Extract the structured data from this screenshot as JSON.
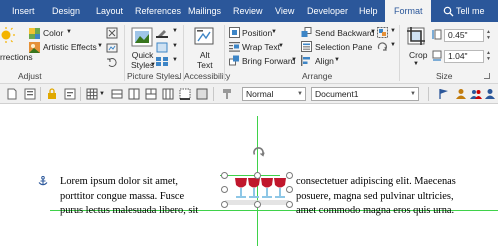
{
  "tabs": [
    {
      "label": "Insert"
    },
    {
      "label": "Design"
    },
    {
      "label": "Layout"
    },
    {
      "label": "References"
    },
    {
      "label": "Mailings"
    },
    {
      "label": "Review"
    },
    {
      "label": "View"
    },
    {
      "label": "Developer"
    },
    {
      "label": "Help"
    },
    {
      "label": "Format"
    }
  ],
  "tell_me": {
    "label": "Tell me"
  },
  "ribbon": {
    "adjust": {
      "corrections_label": "rrections",
      "color_label": "Color",
      "artistic_effects_label": "Artistic Effects",
      "group_label": "Adjust"
    },
    "picture_styles": {
      "quick_styles_label": "Quick\nStyles",
      "group_label": "Picture Styles"
    },
    "accessibility": {
      "alt_text_label": "Alt\nText",
      "group_label": "Accessibility"
    },
    "arrange": {
      "position_label": "Position",
      "wrap_text_label": "Wrap Text",
      "bring_forward_label": "Bring Forward",
      "send_backward_label": "Send Backward",
      "selection_pane_label": "Selection Pane",
      "align_label": "Align",
      "group_label": "Arrange"
    },
    "size": {
      "crop_label": "Crop",
      "height_value": "0.45\"",
      "width_value": "1.04\"",
      "group_label": "Size"
    }
  },
  "toolbar": {
    "style_value": "Normal",
    "document_value": "Document1"
  },
  "document": {
    "left_lines": [
      "Lorem ipsum dolor sit amet,",
      "porttitor congue massa. Fusce",
      "purus lectus malesuada libero, sit"
    ],
    "right_lines": [
      "consectetuer adipiscing elit. Maecenas",
      "posuere, magna sed pulvinar ultricies,",
      "amet commodo magna eros quis urna."
    ]
  },
  "colors": {
    "title_bar": "#2b579a",
    "ribbon": "#f3f3f3",
    "guide": "#3fd24a",
    "wine": "#c0172d"
  }
}
